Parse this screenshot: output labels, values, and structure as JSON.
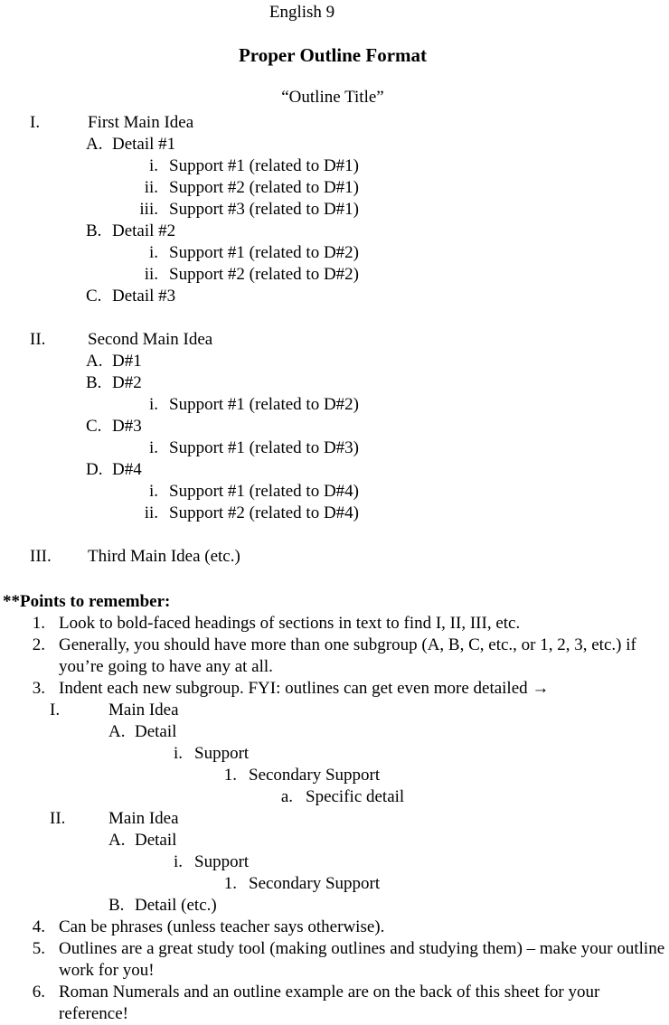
{
  "header": {
    "course": "English 9",
    "title": "Proper Outline Format",
    "outline_title": "“Outline Title”"
  },
  "outline_main": {
    "sections": [
      {
        "marker": "I.",
        "text": "First Main Idea",
        "children": [
          {
            "marker": "A.",
            "text": "Detail #1",
            "children": [
              {
                "marker": "i.",
                "text": "Support #1 (related to D#1)"
              },
              {
                "marker": "ii.",
                "text": "Support #2 (related to D#1)"
              },
              {
                "marker": "iii.",
                "text": "Support #3 (related to D#1)"
              }
            ]
          },
          {
            "marker": "B.",
            "text": "Detail #2",
            "children": [
              {
                "marker": "i.",
                "text": "Support #1 (related to D#2)"
              },
              {
                "marker": "ii.",
                "text": "Support #2 (related to D#2)"
              }
            ]
          },
          {
            "marker": "C.",
            "text": "Detail #3",
            "children": []
          }
        ]
      },
      {
        "marker": "II.",
        "text": "Second Main Idea",
        "children": [
          {
            "marker": "A.",
            "text": "D#1",
            "children": []
          },
          {
            "marker": "B.",
            "text": "D#2",
            "children": [
              {
                "marker": "i.",
                "text": "Support #1 (related to D#2)"
              }
            ]
          },
          {
            "marker": "C.",
            "text": "D#3",
            "children": [
              {
                "marker": "i.",
                "text": "Support #1 (related to D#3)"
              }
            ]
          },
          {
            "marker": "D.",
            "text": "D#4",
            "children": [
              {
                "marker": "i.",
                "text": "Support #1 (related to D#4)"
              },
              {
                "marker": "ii.",
                "text": "Support #2 (related to D#4)"
              }
            ]
          }
        ]
      },
      {
        "marker": "III.",
        "text": "Third Main Idea (etc.)",
        "children": []
      }
    ]
  },
  "points": {
    "heading": "**Points to remember:",
    "items": [
      {
        "marker": "1.",
        "text": "Look to bold-faced headings of sections in text to find I, II, III, etc."
      },
      {
        "marker": "2.",
        "text": "Generally, you should have more than one subgroup (A, B, C, etc., or 1, 2, 3, etc.) if you’re going to have any at all."
      },
      {
        "marker": "3.",
        "text": "Indent each new subgroup. FYI: outlines can get even more detailed →"
      },
      {
        "marker": "4.",
        "text": "Can be phrases (unless teacher says otherwise)."
      },
      {
        "marker": "5.",
        "text": "Outlines are a great study tool (making outlines and studying them) – make your outline work for you!"
      },
      {
        "marker": "6.",
        "text": "Roman Numerals and an outline example are on the back of this sheet for your reference!"
      }
    ]
  },
  "example_outline": {
    "rows": [
      {
        "marker": "I.",
        "text": "Main Idea",
        "level": "roman"
      },
      {
        "marker": "A.",
        "text": "Detail",
        "level": "alpha"
      },
      {
        "marker": "i.",
        "text": "Support",
        "level": "lower"
      },
      {
        "marker": "1.",
        "text": "Secondary Support",
        "level": "num"
      },
      {
        "marker": "a.",
        "text": "Specific detail",
        "level": "alow"
      },
      {
        "marker": "II.",
        "text": "Main Idea",
        "level": "roman"
      },
      {
        "marker": "A.",
        "text": "Detail",
        "level": "alpha"
      },
      {
        "marker": "i.",
        "text": "Support",
        "level": "lower"
      },
      {
        "marker": "1.",
        "text": "Secondary Support",
        "level": "num"
      },
      {
        "marker": "B.",
        "text": "Detail (etc.)",
        "level": "alpha"
      }
    ]
  }
}
